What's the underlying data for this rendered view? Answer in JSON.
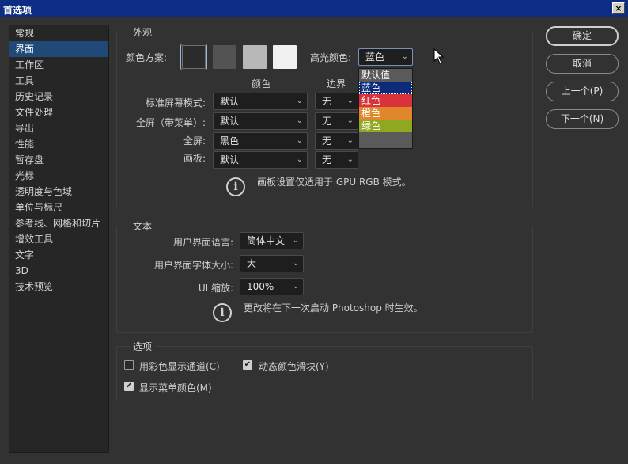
{
  "window": {
    "title": "首选项",
    "close": "×"
  },
  "sidebar": {
    "items": [
      {
        "label": "常规"
      },
      {
        "label": "界面",
        "active": true
      },
      {
        "label": "工作区"
      },
      {
        "label": "工具"
      },
      {
        "label": "历史记录"
      },
      {
        "label": "文件处理"
      },
      {
        "label": "导出"
      },
      {
        "label": "性能"
      },
      {
        "label": "暂存盘"
      },
      {
        "label": "光标"
      },
      {
        "label": "透明度与色域"
      },
      {
        "label": "单位与标尺"
      },
      {
        "label": "参考线、网格和切片"
      },
      {
        "label": "增效工具"
      },
      {
        "label": "文字"
      },
      {
        "label": "3D"
      },
      {
        "label": "技术预览"
      }
    ]
  },
  "appearance": {
    "title": "外观",
    "color_scheme_label": "颜色方案:",
    "swatches": [
      "#2b2b2b",
      "#535353",
      "#b8b8b8",
      "#f0f0f0"
    ],
    "highlight_label": "高光颜色:",
    "highlight_value": "蓝色",
    "highlight_options": [
      {
        "label": "默认值",
        "color": "#5a5a5a"
      },
      {
        "label": "蓝色",
        "color": "#0b2a7a"
      },
      {
        "label": "红色",
        "color": "#d8333a"
      },
      {
        "label": "橙色",
        "color": "#e0862b"
      },
      {
        "label": "绿色",
        "color": "#8ea81f"
      }
    ],
    "col_color": "颜色",
    "col_border": "边界",
    "rows": [
      {
        "label": "标准屏幕模式:",
        "color": "默认",
        "border": "无"
      },
      {
        "label": "全屏（带菜单）:",
        "color": "默认",
        "border": "无"
      },
      {
        "label": "全屏:",
        "color": "黑色",
        "border": "无"
      },
      {
        "label": "画板:",
        "color": "默认",
        "border": "无"
      }
    ],
    "note": "画板设置仅适用于 GPU RGB 模式。"
  },
  "text_group": {
    "title": "文本",
    "ui_lang_label": "用户界面语言:",
    "ui_lang_value": "简体中文",
    "ui_font_label": "用户界面字体大小:",
    "ui_font_value": "大",
    "ui_scale_label": "UI 缩放:",
    "ui_scale_value": "100%",
    "note": "更改将在下一次启动 Photoshop 时生效。"
  },
  "options": {
    "title": "选项",
    "color_channels": {
      "label": "用彩色显示通道(C)",
      "checked": false
    },
    "dynamic_sliders": {
      "label": "动态颜色滑块(Y)",
      "checked": true
    },
    "menu_colors": {
      "label": "显示菜单颜色(M)",
      "checked": true
    }
  },
  "buttons": {
    "ok": "确定",
    "cancel": "取消",
    "prev": "上一个(P)",
    "next": "下一个(N)"
  },
  "icons": {
    "info": "i",
    "check": "✔",
    "chevron": "⌄"
  }
}
